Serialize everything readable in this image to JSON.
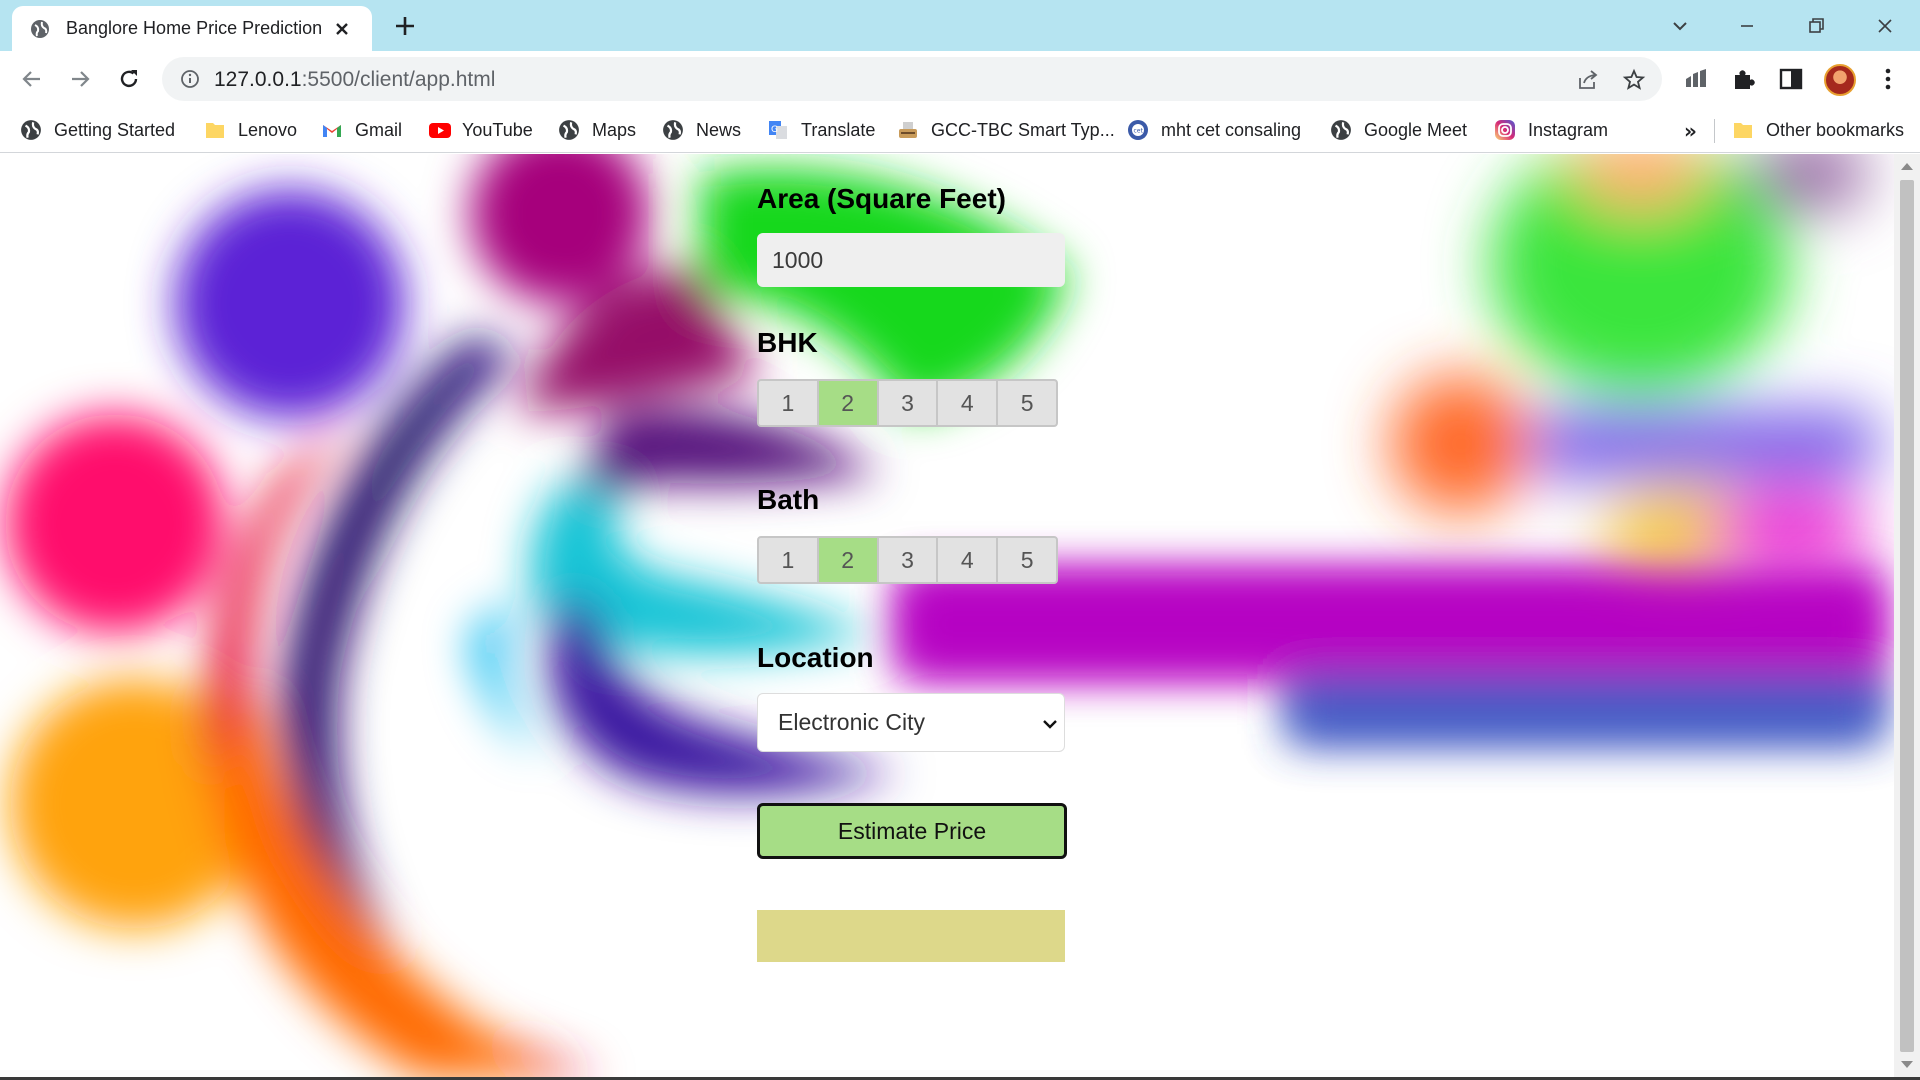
{
  "tab": {
    "title": "Banglore Home Price Prediction"
  },
  "omnibox": {
    "host": "127.0.0.1",
    "path": ":5500/client/app.html"
  },
  "bookmarks": [
    {
      "label": "Getting Started",
      "icon": "globe-icon"
    },
    {
      "label": "Lenovo",
      "icon": "folder-icon"
    },
    {
      "label": "Gmail",
      "icon": "gmail-icon"
    },
    {
      "label": "YouTube",
      "icon": "youtube-icon"
    },
    {
      "label": "Maps",
      "icon": "globe-icon"
    },
    {
      "label": "News",
      "icon": "globe-icon"
    },
    {
      "label": "Translate",
      "icon": "translate-icon"
    },
    {
      "label": "GCC-TBC Smart Typ...",
      "icon": "typewriter-icon"
    },
    {
      "label": "mht cet consaling",
      "icon": "cet-icon"
    },
    {
      "label": "Google Meet",
      "icon": "globe-icon"
    },
    {
      "label": "Instagram",
      "icon": "instagram-icon"
    }
  ],
  "bookmarks_more": "»",
  "other_bookmarks": "Other bookmarks",
  "form": {
    "area_label": "Area (Square Feet)",
    "area_value": "1000",
    "bhk_label": "BHK",
    "bhk_options": [
      "1",
      "2",
      "3",
      "4",
      "5"
    ],
    "bhk_selected": "2",
    "bath_label": "Bath",
    "bath_options": [
      "1",
      "2",
      "3",
      "4",
      "5"
    ],
    "bath_selected": "2",
    "location_label": "Location",
    "location_value": "Electronic City",
    "estimate_button": "Estimate Price",
    "result_text": ""
  },
  "colors": {
    "tabstrip": "#b6e4f1",
    "selected_option": "#a6dd86",
    "button": "#a6dd86",
    "result_box": "#ddd88a"
  }
}
